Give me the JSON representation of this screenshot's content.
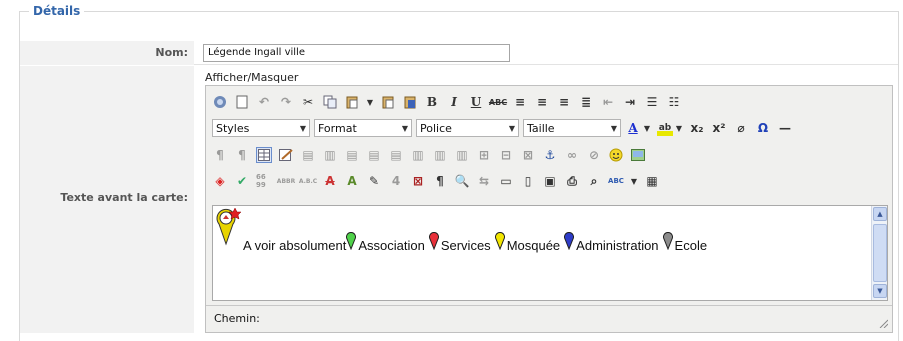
{
  "section": {
    "legend": "Détails"
  },
  "name_field": {
    "label": "Nom:",
    "value": "Légende Ingall ville"
  },
  "text_field": {
    "label": "Texte avant la carte:",
    "toggle_label": "Afficher/Masquer"
  },
  "toolbar": {
    "selects": [
      {
        "label": "Styles"
      },
      {
        "label": "Format"
      },
      {
        "label": "Police"
      },
      {
        "label": "Taille"
      }
    ]
  },
  "content": {
    "legend_items": [
      {
        "label": "A voir absolument",
        "color": "#e8d400"
      },
      {
        "label": "Association",
        "color": "#4fd14a"
      },
      {
        "label": "Services",
        "color": "#e8303a"
      },
      {
        "label": "Mosquée",
        "color": "#f2e600"
      },
      {
        "label": "Administration",
        "color": "#2e3cc8"
      },
      {
        "label": "Ecole",
        "color": "#8c8c8c"
      }
    ]
  },
  "status": {
    "path_label": "Chemin:"
  },
  "colors": {
    "accent": "#3366aa",
    "label_bg": "#f2f2f2",
    "editor_bg": "#f0f0ee"
  }
}
